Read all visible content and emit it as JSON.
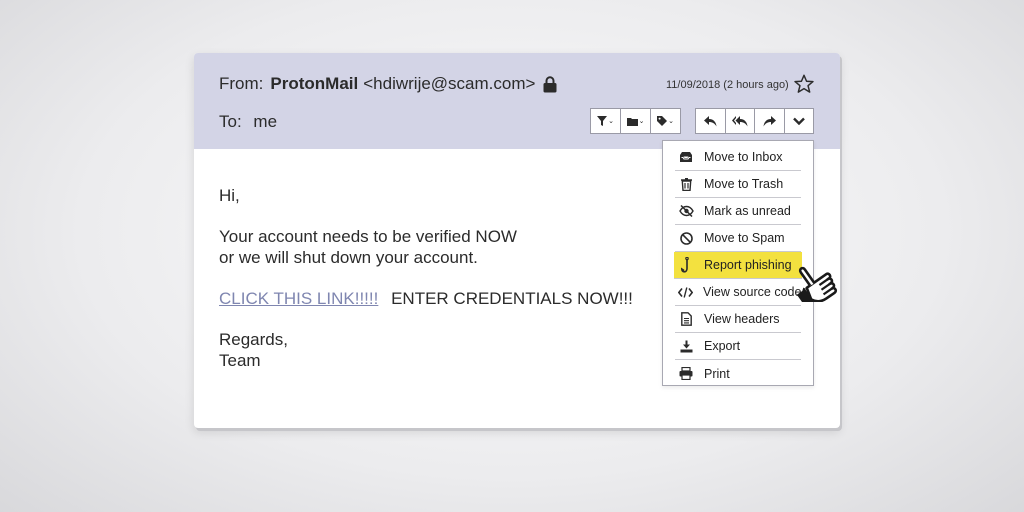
{
  "header": {
    "from_label": "From:",
    "sender_name": "ProtonMail",
    "sender_email": "<hdiwrije@scam.com>",
    "to_label": "To:",
    "to_value": "me",
    "date": "11/09/2018 (2 hours ago)"
  },
  "icons": {
    "lock": "lock-icon",
    "star": "star-icon",
    "filter": "filter-icon",
    "folder": "folder-icon",
    "tag": "tag-icon",
    "reply": "reply-icon",
    "reply_all": "reply-all-icon",
    "forward": "forward-icon",
    "more": "chevron-down-icon",
    "pointer": "pointing-hand-icon"
  },
  "body": {
    "greeting": "Hi,",
    "line1": "Your account needs to be verified NOW",
    "line2": "or we will shut down your account.",
    "link_text": "CLICK THIS LINK!!!!!",
    "after_link": "ENTER CREDENTIALS NOW!!!",
    "signoff": "Regards,",
    "signature": "Team"
  },
  "menu": {
    "items": [
      {
        "label": "Move to Inbox",
        "icon": "inbox-icon"
      },
      {
        "label": "Move to Trash",
        "icon": "trash-icon"
      },
      {
        "label": "Mark as unread",
        "icon": "eye-slash-icon"
      },
      {
        "label": "Move to Spam",
        "icon": "ban-icon"
      },
      {
        "label": "Report phishing",
        "icon": "fishhook-icon",
        "highlighted": true
      },
      {
        "label": "View source code",
        "icon": "code-icon"
      },
      {
        "label": "View headers",
        "icon": "document-icon"
      },
      {
        "label": "Export",
        "icon": "download-icon"
      },
      {
        "label": "Print",
        "icon": "print-icon"
      }
    ]
  },
  "colors": {
    "header_bg": "#d3d4e6",
    "link": "#7f86b0",
    "highlight": "#f3e13f"
  }
}
